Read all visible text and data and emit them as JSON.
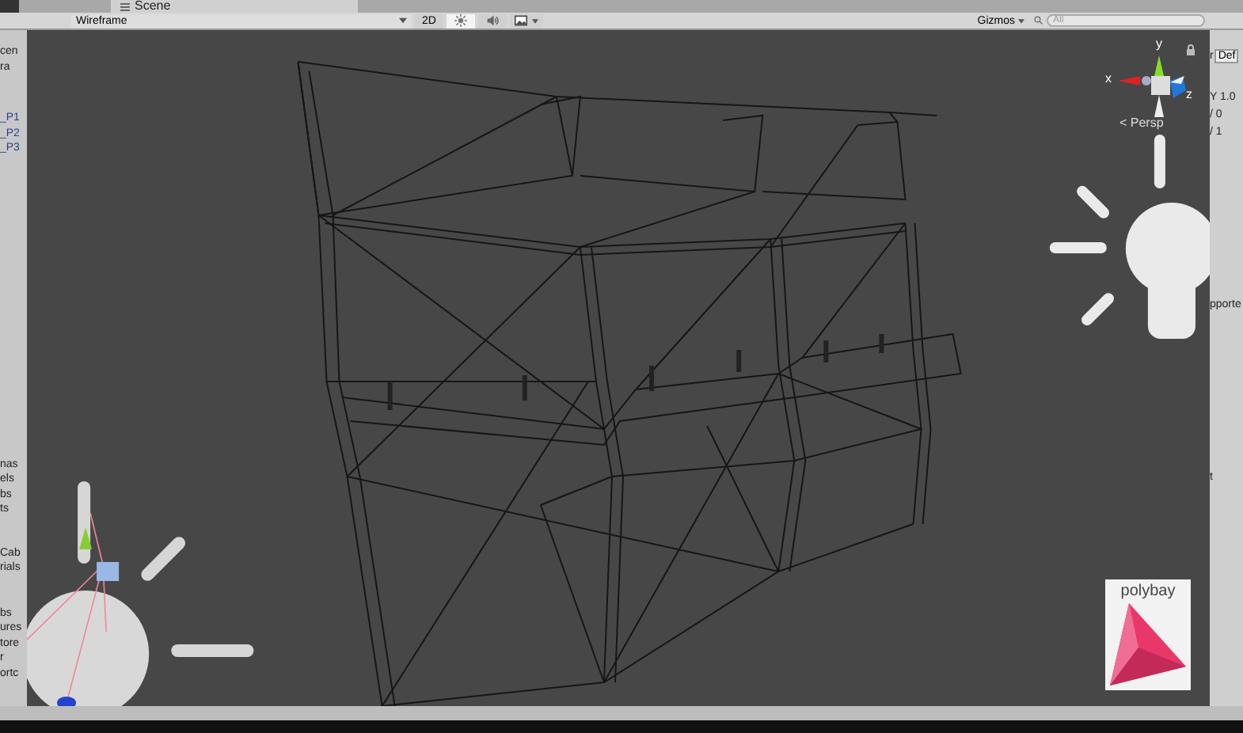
{
  "window": {
    "tab": "Scene"
  },
  "toolbar": {
    "render_mode": "Wireframe",
    "toggles": [
      {
        "kind": "text",
        "label": "2D",
        "selected": false
      },
      {
        "kind": "light",
        "selected": true
      },
      {
        "kind": "audio",
        "selected": false
      },
      {
        "kind": "effects",
        "selected": false
      }
    ],
    "gizmos": "Gizmos",
    "search": {
      "placeholder": "All"
    }
  },
  "left_panel": {
    "groups": [
      [
        "cen",
        "ra"
      ],
      [
        "_P1",
        "_P2",
        "_P3"
      ],
      [
        "nas",
        "els",
        "bs",
        "ts"
      ],
      [
        "Cab",
        "rials"
      ],
      [
        "bs",
        "ures",
        "tore",
        "r",
        "ortc"
      ]
    ]
  },
  "right_panel": {
    "items": [
      {
        "kind": "button",
        "label": "Def",
        "prefix": "r"
      },
      {
        "kind": "text",
        "label": "Y 1.0"
      },
      {
        "kind": "text",
        "label": "/ 0"
      },
      {
        "kind": "text",
        "label": "/ 1"
      },
      {
        "kind": "text",
        "label": "pporte"
      },
      {
        "kind": "text",
        "label": "t"
      }
    ]
  },
  "scene": {
    "axes": {
      "x": "x",
      "y": "y",
      "z": "z"
    },
    "projection": "< Persp",
    "logo": "polybay"
  }
}
